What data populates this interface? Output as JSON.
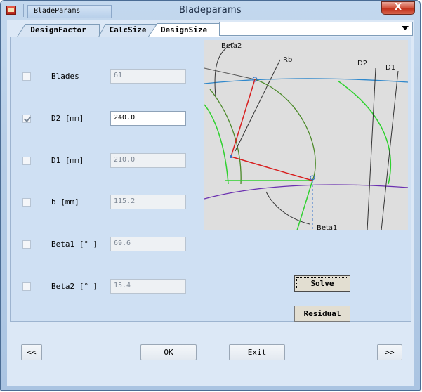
{
  "window": {
    "title": "Bladeparams",
    "tab_label": "BladeParams",
    "close_glyph": "X"
  },
  "tabs": [
    {
      "label": "DesignFactor"
    },
    {
      "label": "CalcSize"
    },
    {
      "label": "DesignSize",
      "selected": true
    }
  ],
  "dropdown": {
    "value": ""
  },
  "fields": [
    {
      "label": "Blades",
      "value": "61",
      "checked": false,
      "editable": false
    },
    {
      "label": "D2 [mm]",
      "value": "240.0",
      "checked": true,
      "editable": true
    },
    {
      "label": "D1 [mm]",
      "value": "210.0",
      "checked": false,
      "editable": false
    },
    {
      "label": "b [mm]",
      "value": "115.2",
      "checked": false,
      "editable": false
    },
    {
      "label": "Beta1 [° ]",
      "value": "69.6",
      "checked": false,
      "editable": false
    },
    {
      "label": "Beta2 [° ]",
      "value": "15.4",
      "checked": false,
      "editable": false
    }
  ],
  "diagram": {
    "labels": {
      "beta2": "Beta2",
      "rb": "Rb",
      "d2": "D2",
      "d1": "D1",
      "beta1": "Beta1"
    },
    "colors": {
      "background": "#dedede",
      "outer_circle": "#2f88cc",
      "inner_circle": "#6a2fb0",
      "blade_arc": "#4c8a2a",
      "green_line": "#2fd12f",
      "red_line": "#d81f1f",
      "leader": "#333333"
    }
  },
  "buttons": {
    "solve": "Solve",
    "residual": "Residual",
    "prev": "<<",
    "ok": "OK",
    "exit": "Exit",
    "next": ">>"
  }
}
